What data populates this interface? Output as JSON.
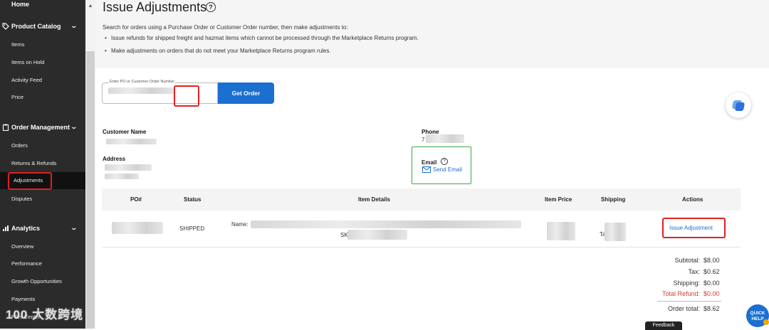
{
  "sidebar": {
    "home": "Home",
    "product_catalog": {
      "heading": "Product Catalog",
      "items": [
        "Items",
        "Items on Hold",
        "Activity Feed",
        "Price"
      ]
    },
    "order_management": {
      "heading": "Order Management",
      "items": [
        "Orders",
        "Returns & Refunds",
        "Adjustments",
        "Disputes"
      ],
      "active": "Adjustments"
    },
    "analytics": {
      "heading": "Analytics",
      "items": [
        "Overview",
        "Performance",
        "Growth Opportunities",
        "Payments",
        "Files Center"
      ]
    }
  },
  "page": {
    "title": "Issue Adjustments",
    "intro": "Search for orders using a Purchase Order or Customer Order number, then make adjustments to:",
    "bullets": [
      "Issue refunds for shipped freight and hazmat items which cannot be processed through the Marketplace Returns program.",
      "Make adjustments on orders that do not meet your Marketplace Returns program rules."
    ]
  },
  "search": {
    "label": "Enter PO or Customer Order Number",
    "button": "Get Order"
  },
  "customer": {
    "name_label": "Customer Name",
    "address_label": "Address",
    "phone_label": "Phone",
    "phone_partial": "7",
    "email_label": "Email",
    "send_email": "Send Email"
  },
  "table": {
    "headers": [
      "PO#",
      "Status",
      "Item Details",
      "Item Price",
      "Shipping",
      "Actions"
    ],
    "row": {
      "status": "SHIPPED",
      "name_label": "Name:",
      "sku_label": "SK",
      "shipping_partial": "Ta",
      "action": "Issue Adjustment"
    }
  },
  "totals": {
    "subtotal_label": "Subtotal:",
    "subtotal": "$8.00",
    "tax_label": "Tax:",
    "tax": "$0.62",
    "shipping_label": "Shipping:",
    "shipping": "$0.00",
    "refund_label": "Total Refund:",
    "refund": "$0.00",
    "order_total_label": "Order total:",
    "order_total": "$8.62"
  },
  "footer": {
    "watermark": "100 大数跨境",
    "feedback": "Feedback",
    "quick_help": "QUICK HELP"
  },
  "colors": {
    "accent": "#1a6fd1",
    "sidebar": "#2b2b2b",
    "highlight": "#e02020",
    "refund": "#d9382f",
    "email_border": "#39a845"
  }
}
